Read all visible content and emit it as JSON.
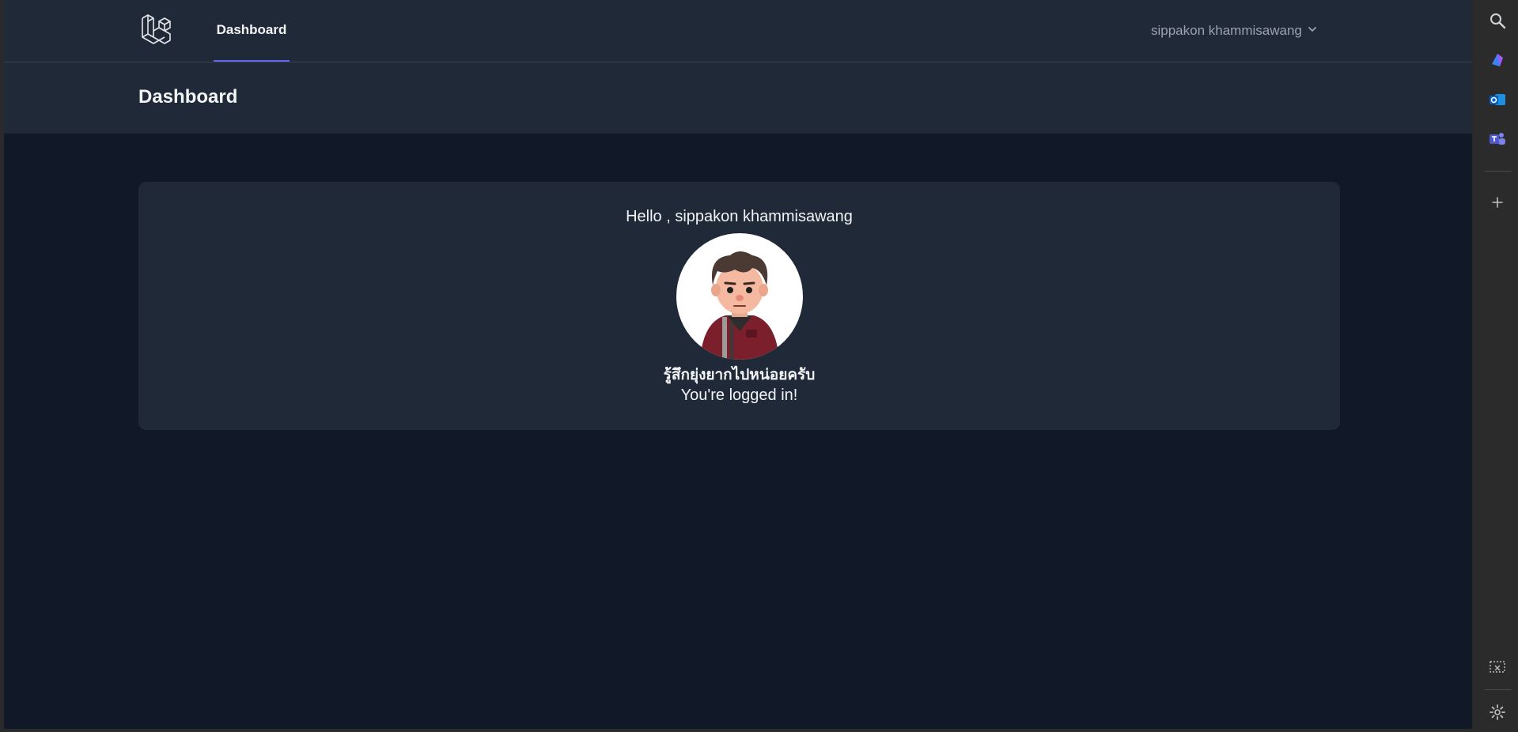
{
  "nav": {
    "logo_icon": "laravel-logo-icon",
    "dashboard_link": "Dashboard",
    "user_name": "sippakon khammisawang",
    "user_menu_icon": "chevron-down-icon"
  },
  "header": {
    "title": "Dashboard"
  },
  "card": {
    "greeting": "Hello , sippakon khammisawang",
    "avatar_icon": "avatar-illustration",
    "caption": "รู้สึกยุ่งยากไปหน่อยครับ",
    "status": "You're logged in!"
  },
  "sidebar": {
    "items": [
      {
        "icon": "search-icon"
      },
      {
        "icon": "copilot-icon"
      },
      {
        "icon": "outlook-icon"
      },
      {
        "icon": "teams-icon"
      },
      {
        "icon": "add-icon"
      },
      {
        "icon": "screenshot-icon"
      },
      {
        "icon": "gear-icon"
      }
    ]
  },
  "colors": {
    "page_bg": "#111827",
    "panel_bg": "#1f2937",
    "accent": "#6366f1",
    "text": "#f3f4f6",
    "muted_text": "#9ca3af"
  }
}
